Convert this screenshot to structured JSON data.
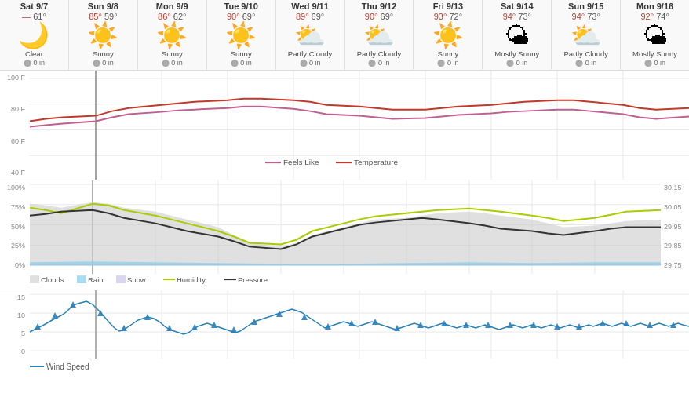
{
  "days": [
    {
      "name": "Sat 9/7",
      "high": "—",
      "low": "61°",
      "icon": "🌙",
      "condition": "Clear",
      "precip": "0 in",
      "moonIcon": true
    },
    {
      "name": "Sun 9/8",
      "high": "85°",
      "low": "59°",
      "icon": "☀️",
      "condition": "Sunny",
      "precip": "0 in"
    },
    {
      "name": "Mon 9/9",
      "high": "86°",
      "low": "62°",
      "icon": "☀️",
      "condition": "Sunny",
      "precip": "0 in"
    },
    {
      "name": "Tue 9/10",
      "high": "90°",
      "low": "69°",
      "icon": "☀️",
      "condition": "Sunny",
      "precip": "0 in"
    },
    {
      "name": "Wed 9/11",
      "high": "89°",
      "low": "69°",
      "icon": "⛅",
      "condition": "Partly Cloudy",
      "precip": "0 in"
    },
    {
      "name": "Thu 9/12",
      "high": "90°",
      "low": "69°",
      "icon": "⛅",
      "condition": "Partly Cloudy",
      "precip": "0 in"
    },
    {
      "name": "Fri 9/13",
      "high": "93°",
      "low": "72°",
      "icon": "☀️",
      "condition": "Sunny",
      "precip": "0 in"
    },
    {
      "name": "Sat 9/14",
      "high": "94°",
      "low": "73°",
      "icon": "🌤",
      "condition": "Mostly Sunny",
      "precip": "0 in"
    },
    {
      "name": "Sun 9/15",
      "high": "94°",
      "low": "73°",
      "icon": "⛅",
      "condition": "Partly Cloudy",
      "precip": "0 in"
    },
    {
      "name": "Mon 9/16",
      "high": "92°",
      "low": "74°",
      "icon": "🌤",
      "condition": "Mostly Sunny",
      "precip": "0 in"
    }
  ],
  "chart1": {
    "y_labels": [
      "100 F",
      "80 F",
      "60 F",
      "40 F"
    ],
    "legend": [
      {
        "label": "Feels Like",
        "color": "#c06090",
        "type": "line"
      },
      {
        "label": "Temperature",
        "color": "#c0392b",
        "type": "line"
      }
    ]
  },
  "chart2": {
    "y_labels": [
      "100%",
      "75%",
      "50%",
      "25%",
      "0%"
    ],
    "y_labels_right": [
      "30.15",
      "30.05",
      "29.95",
      "29.85",
      "29.75"
    ],
    "legend": [
      {
        "label": "Clouds",
        "color": "#ccc",
        "type": "box"
      },
      {
        "label": "Rain",
        "color": "#87ceeb",
        "type": "box"
      },
      {
        "label": "Snow",
        "color": "#b0b0e0",
        "type": "box"
      },
      {
        "label": "Humidity",
        "color": "#aacc00",
        "type": "line"
      },
      {
        "label": "Pressure",
        "color": "#333",
        "type": "line"
      }
    ]
  },
  "chart3": {
    "y_labels": [
      "15",
      "10",
      "5",
      "0"
    ],
    "legend": [
      {
        "label": "Wind Speed",
        "color": "#2980b9",
        "type": "line"
      }
    ]
  }
}
